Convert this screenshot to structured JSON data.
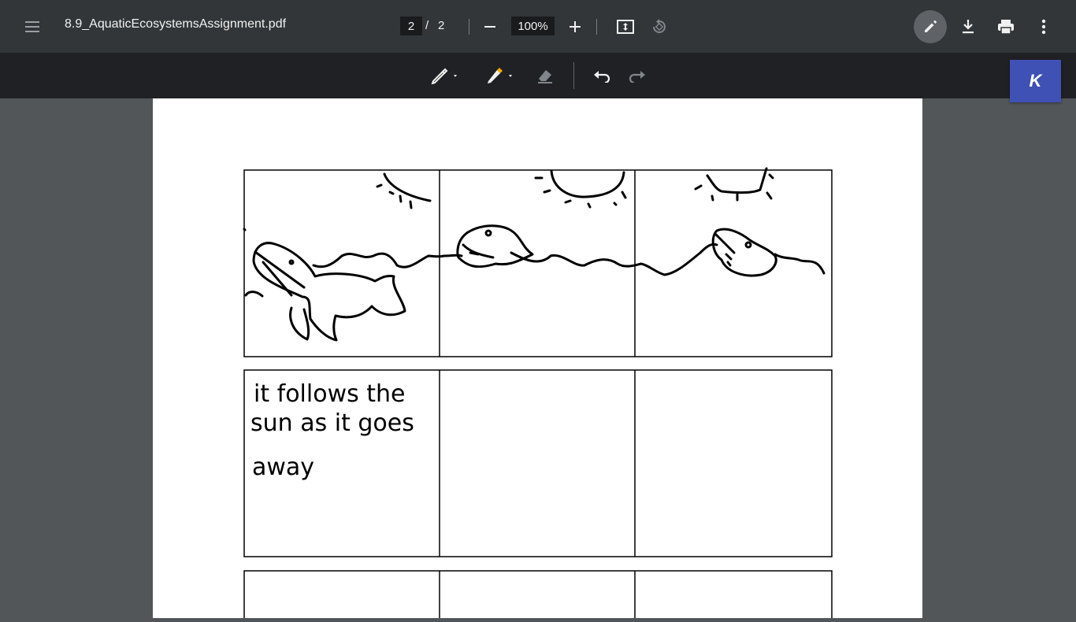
{
  "toolbar": {
    "file_name": "8.9_AquaticEcosystemsAssignment.pdf",
    "current_page": "2",
    "page_separator": "/",
    "total_pages": "2",
    "zoom": "100%",
    "icons": [
      "menu-icon",
      "minus-icon",
      "plus-icon",
      "fit-page-icon",
      "rotate-icon",
      "pencil-icon",
      "download-icon",
      "print-icon",
      "more-vert-icon"
    ]
  },
  "annotation_bar": {
    "icons": [
      "pen-icon",
      "highlighter-icon",
      "eraser-icon",
      "undo-icon",
      "redo-icon"
    ],
    "highlighter_color": "#f9ab00"
  },
  "extension": {
    "label": "K",
    "color": "#3f51b5"
  },
  "document": {
    "handwriting": {
      "line1": "it follows the",
      "line2": "sun as it goes",
      "line3": "away"
    }
  },
  "colors": {
    "toolbar_bg": "#323639",
    "annotation_bg": "#202124",
    "viewer_bg": "#525659",
    "page_bg": "#ffffff"
  }
}
